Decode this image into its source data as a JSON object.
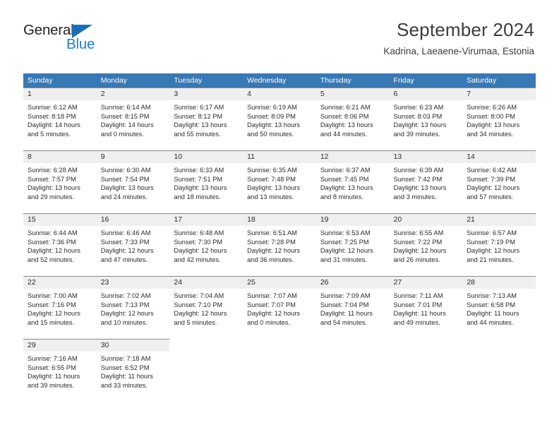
{
  "brand": {
    "name_top": "General",
    "name_bottom": "Blue",
    "accent_color": "#1c7fd6",
    "triangle_color": "#1c6fb5"
  },
  "header": {
    "title": "September 2024",
    "subtitle": "Kadrina, Laeaene-Virumaa, Estonia"
  },
  "calendar": {
    "header_bg": "#3878b4",
    "daynum_bg": "#efefef",
    "weekday_names": [
      "Sunday",
      "Monday",
      "Tuesday",
      "Wednesday",
      "Thursday",
      "Friday",
      "Saturday"
    ],
    "weeks": [
      [
        {
          "day": "1",
          "sunrise": "Sunrise: 6:12 AM",
          "sunset": "Sunset: 8:18 PM",
          "daylight_line1": "Daylight: 14 hours",
          "daylight_line2": "and 5 minutes."
        },
        {
          "day": "2",
          "sunrise": "Sunrise: 6:14 AM",
          "sunset": "Sunset: 8:15 PM",
          "daylight_line1": "Daylight: 14 hours",
          "daylight_line2": "and 0 minutes."
        },
        {
          "day": "3",
          "sunrise": "Sunrise: 6:17 AM",
          "sunset": "Sunset: 8:12 PM",
          "daylight_line1": "Daylight: 13 hours",
          "daylight_line2": "and 55 minutes."
        },
        {
          "day": "4",
          "sunrise": "Sunrise: 6:19 AM",
          "sunset": "Sunset: 8:09 PM",
          "daylight_line1": "Daylight: 13 hours",
          "daylight_line2": "and 50 minutes."
        },
        {
          "day": "5",
          "sunrise": "Sunrise: 6:21 AM",
          "sunset": "Sunset: 8:06 PM",
          "daylight_line1": "Daylight: 13 hours",
          "daylight_line2": "and 44 minutes."
        },
        {
          "day": "6",
          "sunrise": "Sunrise: 6:23 AM",
          "sunset": "Sunset: 8:03 PM",
          "daylight_line1": "Daylight: 13 hours",
          "daylight_line2": "and 39 minutes."
        },
        {
          "day": "7",
          "sunrise": "Sunrise: 6:26 AM",
          "sunset": "Sunset: 8:00 PM",
          "daylight_line1": "Daylight: 13 hours",
          "daylight_line2": "and 34 minutes."
        }
      ],
      [
        {
          "day": "8",
          "sunrise": "Sunrise: 6:28 AM",
          "sunset": "Sunset: 7:57 PM",
          "daylight_line1": "Daylight: 13 hours",
          "daylight_line2": "and 29 minutes."
        },
        {
          "day": "9",
          "sunrise": "Sunrise: 6:30 AM",
          "sunset": "Sunset: 7:54 PM",
          "daylight_line1": "Daylight: 13 hours",
          "daylight_line2": "and 24 minutes."
        },
        {
          "day": "10",
          "sunrise": "Sunrise: 6:33 AM",
          "sunset": "Sunset: 7:51 PM",
          "daylight_line1": "Daylight: 13 hours",
          "daylight_line2": "and 18 minutes."
        },
        {
          "day": "11",
          "sunrise": "Sunrise: 6:35 AM",
          "sunset": "Sunset: 7:48 PM",
          "daylight_line1": "Daylight: 13 hours",
          "daylight_line2": "and 13 minutes."
        },
        {
          "day": "12",
          "sunrise": "Sunrise: 6:37 AM",
          "sunset": "Sunset: 7:45 PM",
          "daylight_line1": "Daylight: 13 hours",
          "daylight_line2": "and 8 minutes."
        },
        {
          "day": "13",
          "sunrise": "Sunrise: 6:39 AM",
          "sunset": "Sunset: 7:42 PM",
          "daylight_line1": "Daylight: 13 hours",
          "daylight_line2": "and 3 minutes."
        },
        {
          "day": "14",
          "sunrise": "Sunrise: 6:42 AM",
          "sunset": "Sunset: 7:39 PM",
          "daylight_line1": "Daylight: 12 hours",
          "daylight_line2": "and 57 minutes."
        }
      ],
      [
        {
          "day": "15",
          "sunrise": "Sunrise: 6:44 AM",
          "sunset": "Sunset: 7:36 PM",
          "daylight_line1": "Daylight: 12 hours",
          "daylight_line2": "and 52 minutes."
        },
        {
          "day": "16",
          "sunrise": "Sunrise: 6:46 AM",
          "sunset": "Sunset: 7:33 PM",
          "daylight_line1": "Daylight: 12 hours",
          "daylight_line2": "and 47 minutes."
        },
        {
          "day": "17",
          "sunrise": "Sunrise: 6:48 AM",
          "sunset": "Sunset: 7:30 PM",
          "daylight_line1": "Daylight: 12 hours",
          "daylight_line2": "and 42 minutes."
        },
        {
          "day": "18",
          "sunrise": "Sunrise: 6:51 AM",
          "sunset": "Sunset: 7:28 PM",
          "daylight_line1": "Daylight: 12 hours",
          "daylight_line2": "and 36 minutes."
        },
        {
          "day": "19",
          "sunrise": "Sunrise: 6:53 AM",
          "sunset": "Sunset: 7:25 PM",
          "daylight_line1": "Daylight: 12 hours",
          "daylight_line2": "and 31 minutes."
        },
        {
          "day": "20",
          "sunrise": "Sunrise: 6:55 AM",
          "sunset": "Sunset: 7:22 PM",
          "daylight_line1": "Daylight: 12 hours",
          "daylight_line2": "and 26 minutes."
        },
        {
          "day": "21",
          "sunrise": "Sunrise: 6:57 AM",
          "sunset": "Sunset: 7:19 PM",
          "daylight_line1": "Daylight: 12 hours",
          "daylight_line2": "and 21 minutes."
        }
      ],
      [
        {
          "day": "22",
          "sunrise": "Sunrise: 7:00 AM",
          "sunset": "Sunset: 7:16 PM",
          "daylight_line1": "Daylight: 12 hours",
          "daylight_line2": "and 15 minutes."
        },
        {
          "day": "23",
          "sunrise": "Sunrise: 7:02 AM",
          "sunset": "Sunset: 7:13 PM",
          "daylight_line1": "Daylight: 12 hours",
          "daylight_line2": "and 10 minutes."
        },
        {
          "day": "24",
          "sunrise": "Sunrise: 7:04 AM",
          "sunset": "Sunset: 7:10 PM",
          "daylight_line1": "Daylight: 12 hours",
          "daylight_line2": "and 5 minutes."
        },
        {
          "day": "25",
          "sunrise": "Sunrise: 7:07 AM",
          "sunset": "Sunset: 7:07 PM",
          "daylight_line1": "Daylight: 12 hours",
          "daylight_line2": "and 0 minutes."
        },
        {
          "day": "26",
          "sunrise": "Sunrise: 7:09 AM",
          "sunset": "Sunset: 7:04 PM",
          "daylight_line1": "Daylight: 11 hours",
          "daylight_line2": "and 54 minutes."
        },
        {
          "day": "27",
          "sunrise": "Sunrise: 7:11 AM",
          "sunset": "Sunset: 7:01 PM",
          "daylight_line1": "Daylight: 11 hours",
          "daylight_line2": "and 49 minutes."
        },
        {
          "day": "28",
          "sunrise": "Sunrise: 7:13 AM",
          "sunset": "Sunset: 6:58 PM",
          "daylight_line1": "Daylight: 11 hours",
          "daylight_line2": "and 44 minutes."
        }
      ],
      [
        {
          "day": "29",
          "sunrise": "Sunrise: 7:16 AM",
          "sunset": "Sunset: 6:55 PM",
          "daylight_line1": "Daylight: 11 hours",
          "daylight_line2": "and 39 minutes."
        },
        {
          "day": "30",
          "sunrise": "Sunrise: 7:18 AM",
          "sunset": "Sunset: 6:52 PM",
          "daylight_line1": "Daylight: 11 hours",
          "daylight_line2": "and 33 minutes."
        },
        {
          "day": "",
          "sunrise": "",
          "sunset": "",
          "daylight_line1": "",
          "daylight_line2": ""
        },
        {
          "day": "",
          "sunrise": "",
          "sunset": "",
          "daylight_line1": "",
          "daylight_line2": ""
        },
        {
          "day": "",
          "sunrise": "",
          "sunset": "",
          "daylight_line1": "",
          "daylight_line2": ""
        },
        {
          "day": "",
          "sunrise": "",
          "sunset": "",
          "daylight_line1": "",
          "daylight_line2": ""
        },
        {
          "day": "",
          "sunrise": "",
          "sunset": "",
          "daylight_line1": "",
          "daylight_line2": ""
        }
      ]
    ]
  }
}
